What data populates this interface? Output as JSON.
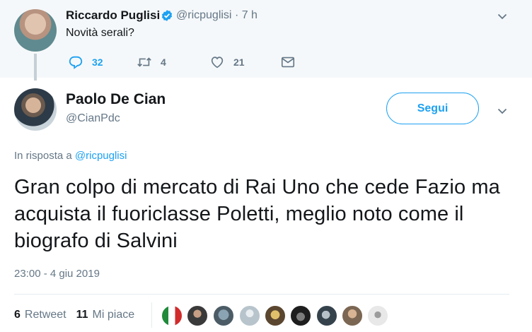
{
  "parent_tweet": {
    "author_name": "Riccardo Puglisi",
    "handle": "@ricpuglisi",
    "time": "· 7 h",
    "text": "Novità serali?",
    "reply_count": "32",
    "retweet_count": "4",
    "like_count": "21"
  },
  "main_tweet": {
    "author_name": "Paolo De Cian",
    "handle": "@CianPdc",
    "follow_label": "Segui",
    "reply_prefix": "In risposta a",
    "reply_to_handle": "@ricpuglisi",
    "text": "Gran colpo di mercato di Rai Uno che cede Fazio ma acquista il fuoriclasse Poletti, meglio noto come il biografo di Salvini",
    "timestamp": "23:00 - 4 giu 2019",
    "retweet_count": "6",
    "retweet_label": "Retweet",
    "like_count": "11",
    "like_label": "Mi piace"
  },
  "colors": {
    "accent": "#1da1f2",
    "muted": "#657786",
    "parent_background": "#f5f8fa"
  },
  "icons": [
    "verified-badge-icon",
    "chevron-down-icon",
    "reply-icon",
    "retweet-icon",
    "heart-icon",
    "direct-message-icon"
  ]
}
